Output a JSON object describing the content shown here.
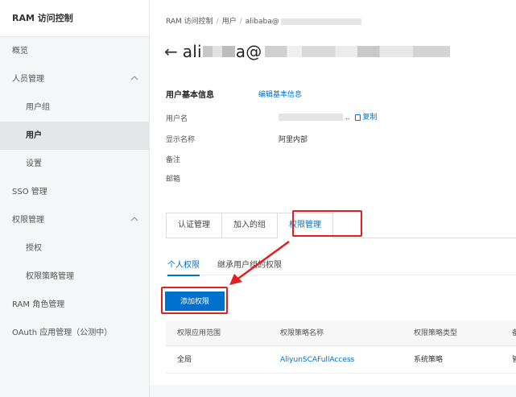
{
  "sidebar": {
    "header": "RAM 访问控制",
    "items": [
      {
        "label": "概览"
      },
      {
        "label": "人员管理",
        "caret": "^"
      },
      {
        "label": "用户组"
      },
      {
        "label": "用户"
      },
      {
        "label": "设置"
      },
      {
        "label": "SSO 管理"
      },
      {
        "label": "权限管理",
        "caret": "^"
      },
      {
        "label": "授权"
      },
      {
        "label": "权限策略管理"
      },
      {
        "label": "RAM 角色管理"
      },
      {
        "label": "OAuth 应用管理（公测中）"
      }
    ]
  },
  "breadcrumb": {
    "root": "RAM 访问控制",
    "sep": "/",
    "users": "用户",
    "current": "alibaba@"
  },
  "title": {
    "back_glyph": "←",
    "prefix": "ali",
    "middle": "a@"
  },
  "basic_info": {
    "title": "用户基本信息",
    "edit_link": "编辑基本信息",
    "username_label": "用户名",
    "username_suffix": "..",
    "copy_label": "复制",
    "display_name_label": "显示名称",
    "display_name_value": "阿里内部",
    "note_label": "备注",
    "email_label": "邮箱"
  },
  "tabs": [
    {
      "label": "认证管理"
    },
    {
      "label": "加入的组"
    },
    {
      "label": "权限管理"
    }
  ],
  "subtabs": [
    {
      "label": "个人权限"
    },
    {
      "label": "继承用户组的权限"
    }
  ],
  "add_button": "添加权限",
  "table": {
    "headers": [
      "权限应用范围",
      "权限策略名称",
      "权限策略类型",
      "备"
    ],
    "rows": [
      [
        "全局",
        "AliyunSCAFullAccess",
        "系统策略",
        "管"
      ]
    ]
  },
  "colors": {
    "accent": "#0070cc",
    "annotation": "#e02020",
    "brand": "#ff6a00"
  }
}
